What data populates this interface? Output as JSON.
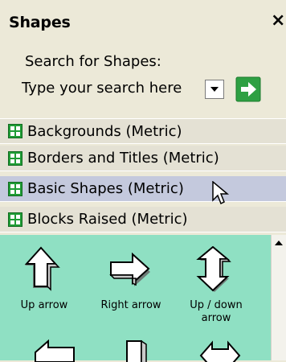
{
  "window": {
    "title": "Shapes",
    "close_label": "×"
  },
  "search": {
    "label": "Search for Shapes:",
    "placeholder": "Type your search here",
    "dropdown_icon": "chevron-down-icon",
    "go_icon": "green-arrow-right-icon"
  },
  "categories": [
    {
      "label": "Backgrounds (Metric)",
      "selected": false
    },
    {
      "label": "Borders and Titles (Metric)",
      "selected": false
    },
    {
      "label": "Basic Shapes (Metric)",
      "selected": true
    },
    {
      "label": "Blocks Raised (Metric)",
      "selected": false
    }
  ],
  "shapes": [
    {
      "label": "Up arrow",
      "icon": "up-arrow-icon"
    },
    {
      "label": "Right arrow",
      "icon": "right-arrow-icon"
    },
    {
      "label": "Up / down arrow",
      "icon": "up-down-arrow-icon"
    }
  ],
  "colors": {
    "panel_bg": "#8fe0c3",
    "selected_row": "#c4c9dd",
    "stencil_icon": "#1f9c35",
    "go_button": "#2ea043"
  }
}
